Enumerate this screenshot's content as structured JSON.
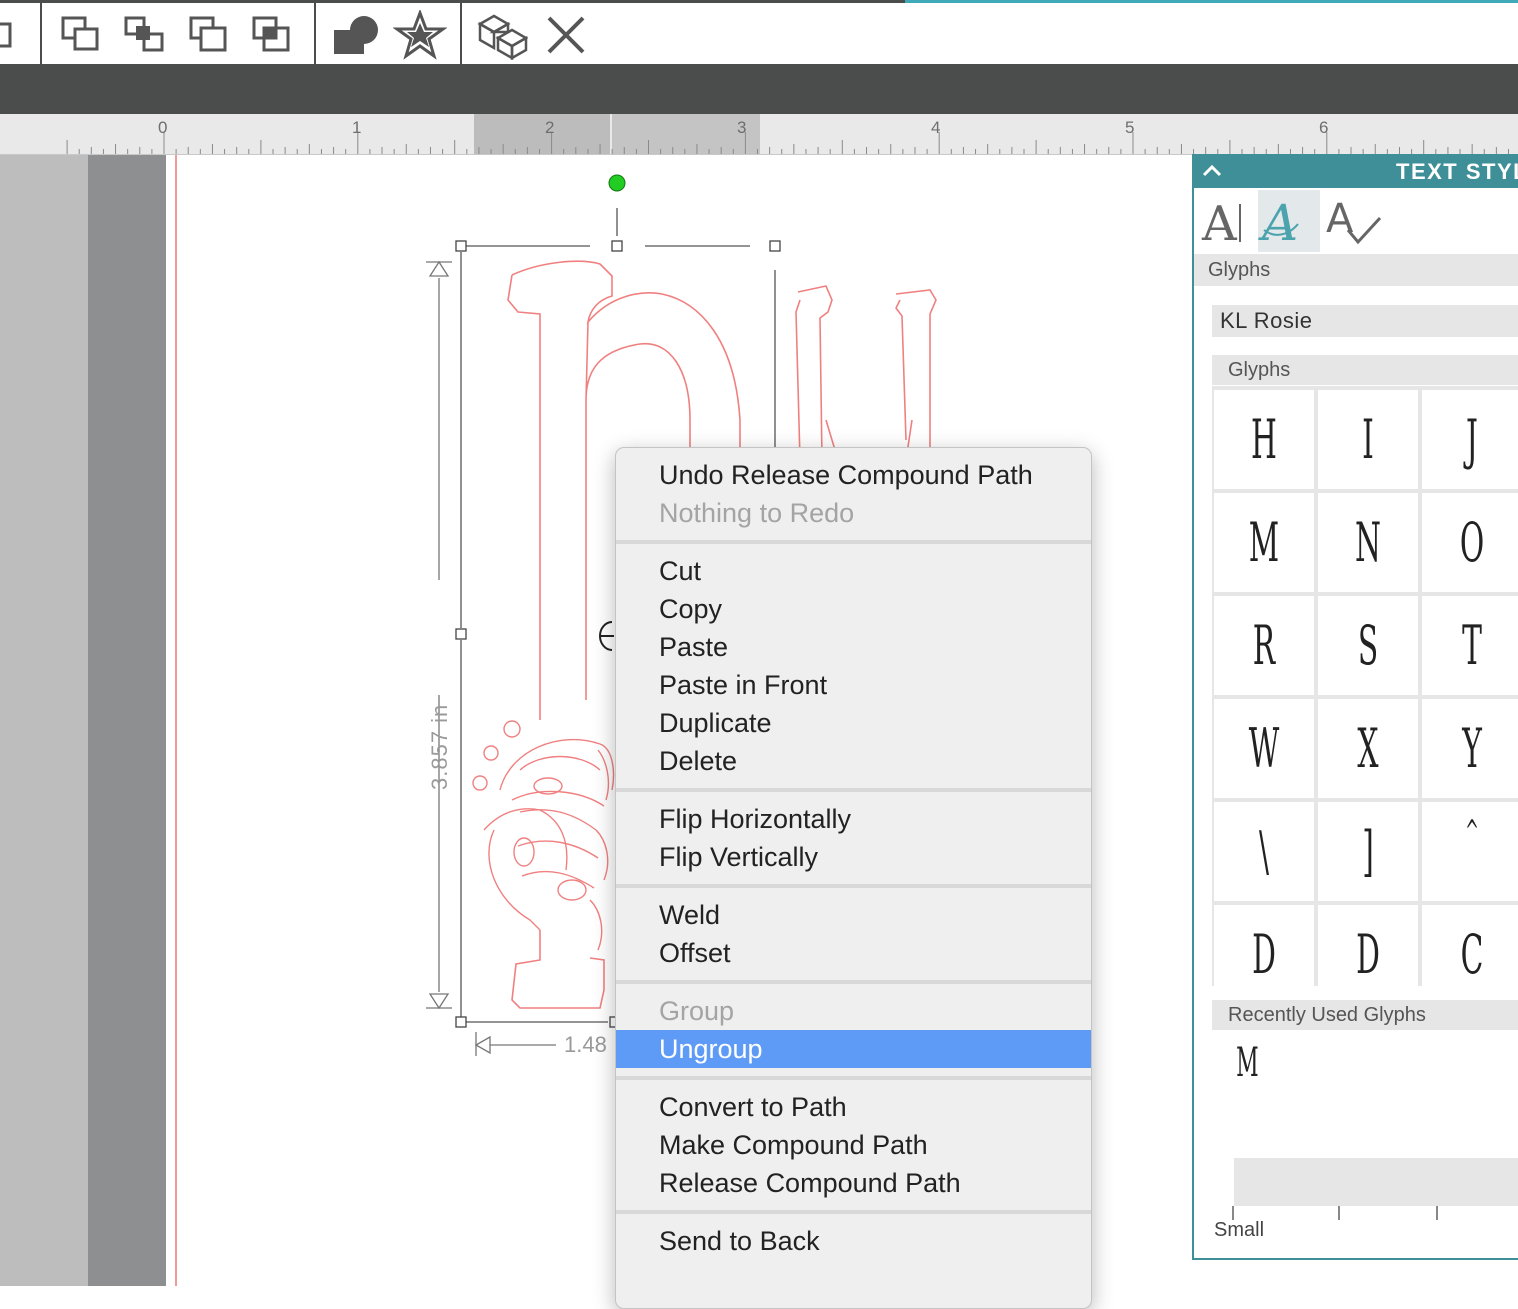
{
  "toolbar": {
    "icons": [
      "front-icon",
      "back-icon",
      "bring-forward-icon",
      "send-backward-icon",
      "shape-add-icon",
      "star-icon",
      "package-icon",
      "close-icon"
    ]
  },
  "ruler": {
    "numbers": [
      "0",
      "1",
      "2",
      "3",
      "4",
      "5",
      "6"
    ]
  },
  "selection": {
    "height_label": "3.857 in",
    "width_label": "1.48"
  },
  "context_menu": {
    "groups": [
      [
        {
          "label": "Undo Release Compound Path",
          "enabled": true
        },
        {
          "label": "Nothing to Redo",
          "enabled": false
        }
      ],
      [
        {
          "label": "Cut",
          "enabled": true
        },
        {
          "label": "Copy",
          "enabled": true
        },
        {
          "label": "Paste",
          "enabled": true
        },
        {
          "label": "Paste in Front",
          "enabled": true
        },
        {
          "label": "Duplicate",
          "enabled": true
        },
        {
          "label": "Delete",
          "enabled": true
        }
      ],
      [
        {
          "label": "Flip Horizontally",
          "enabled": true
        },
        {
          "label": "Flip Vertically",
          "enabled": true
        }
      ],
      [
        {
          "label": "Weld",
          "enabled": true
        },
        {
          "label": "Offset",
          "enabled": true
        }
      ],
      [
        {
          "label": "Group",
          "enabled": false
        },
        {
          "label": "Ungroup",
          "enabled": true,
          "selected": true
        }
      ],
      [
        {
          "label": "Convert to Path",
          "enabled": true
        },
        {
          "label": "Make Compound Path",
          "enabled": true
        },
        {
          "label": "Release Compound Path",
          "enabled": true
        }
      ],
      [
        {
          "label": "Send to Back",
          "enabled": true
        }
      ]
    ],
    "selected_color": "#5e9bf7"
  },
  "panel": {
    "title": "TEXT STYL",
    "tabs": [
      {
        "name": "text-style-tab",
        "active": false
      },
      {
        "name": "glyphs-tab",
        "active": true
      },
      {
        "name": "spell-check-tab",
        "active": false
      }
    ],
    "section_label": "Glyphs",
    "font_name": "KL Rosie",
    "glyphs_label": "Glyphs",
    "glyphs": [
      "H",
      "I",
      "J",
      "M",
      "N",
      "O",
      "R",
      "S",
      "T",
      "W",
      "X",
      "Y",
      "\\",
      "]",
      "^",
      "D",
      "D",
      "C"
    ],
    "recent_label": "Recently Used Glyphs",
    "recent_glyphs": [
      "M"
    ],
    "size_label": "Small",
    "accent_color": "#3f8f99"
  },
  "colors": {
    "toolbar_dark": "#4b4d4c",
    "cut_line": "#f08080",
    "panel_accent": "#3f8f99"
  }
}
